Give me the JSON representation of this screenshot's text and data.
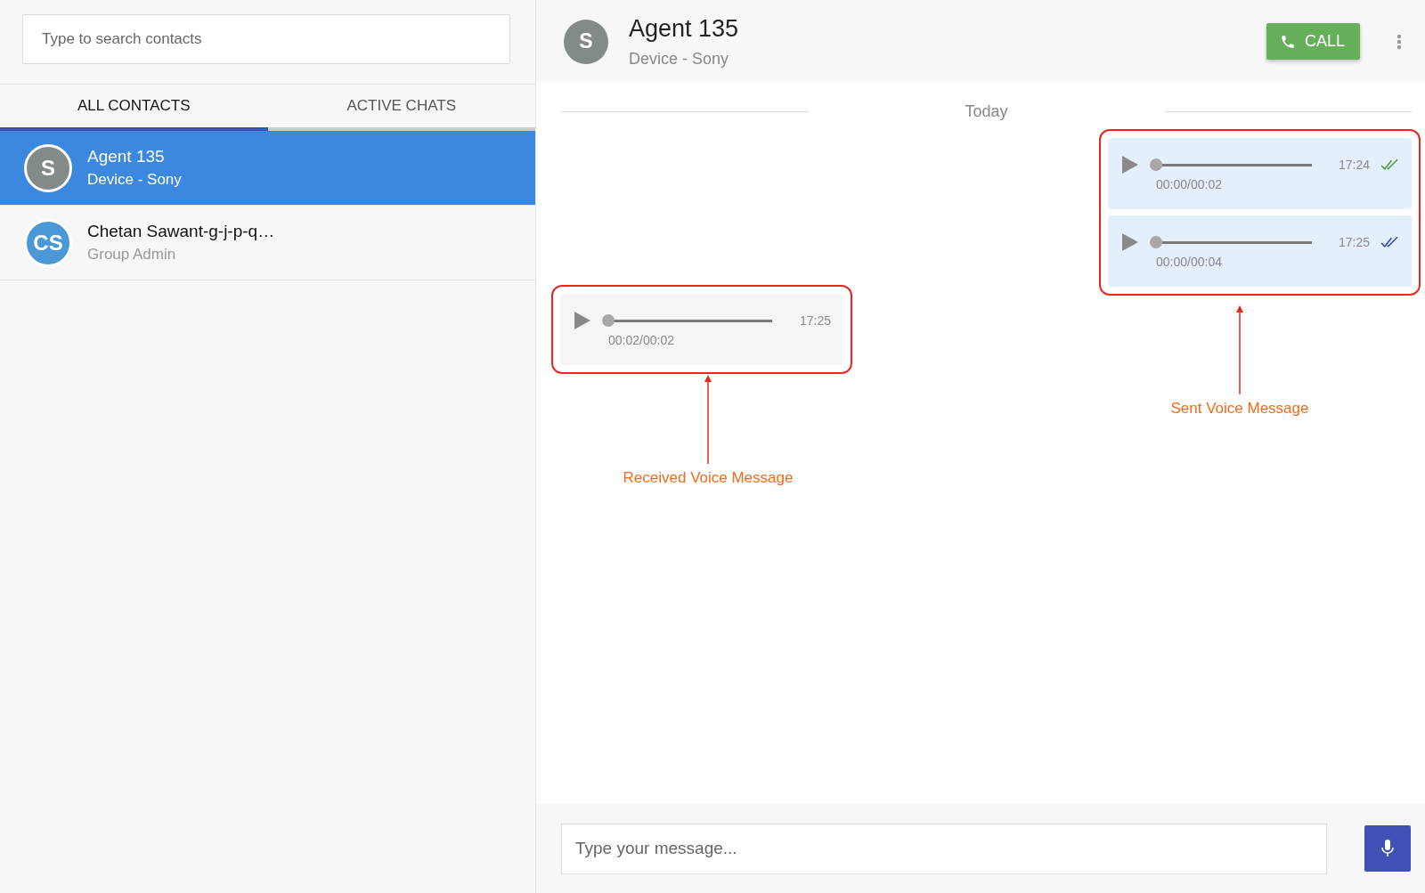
{
  "search": {
    "placeholder": "Type to search contacts"
  },
  "tabs": [
    {
      "label": "ALL CONTACTS",
      "selected": true
    },
    {
      "label": "ACTIVE CHATS",
      "selected": false
    }
  ],
  "contacts": [
    {
      "initials": "S",
      "name": "Agent 135",
      "subtitle": "Device - Sony",
      "selected": true,
      "color": "#838b88"
    },
    {
      "initials": "CS",
      "name": "Chetan Sawant-g-j-p-q…",
      "subtitle": "Group Admin",
      "selected": false,
      "color": "#4a98d8"
    }
  ],
  "chat_header": {
    "initials": "S",
    "name": "Agent 135",
    "subtitle": "Device - Sony",
    "call_button": "CALL"
  },
  "date_divider": "Today",
  "sent_messages": [
    {
      "time": "17:24",
      "duration": "00:00/00:02",
      "level": 0,
      "color": "#4c9a3c"
    },
    {
      "time": "17:25",
      "duration": "00:00/00:04",
      "level": 0,
      "color": "#2f45c0"
    }
  ],
  "received_messages": [
    {
      "time": "17:25",
      "duration": "00:02/00:02",
      "level": 0
    }
  ],
  "annotations": {
    "received": "Received Voice Message",
    "sent": "Sent Voice Message"
  },
  "composer": {
    "placeholder": "Type your message..."
  }
}
